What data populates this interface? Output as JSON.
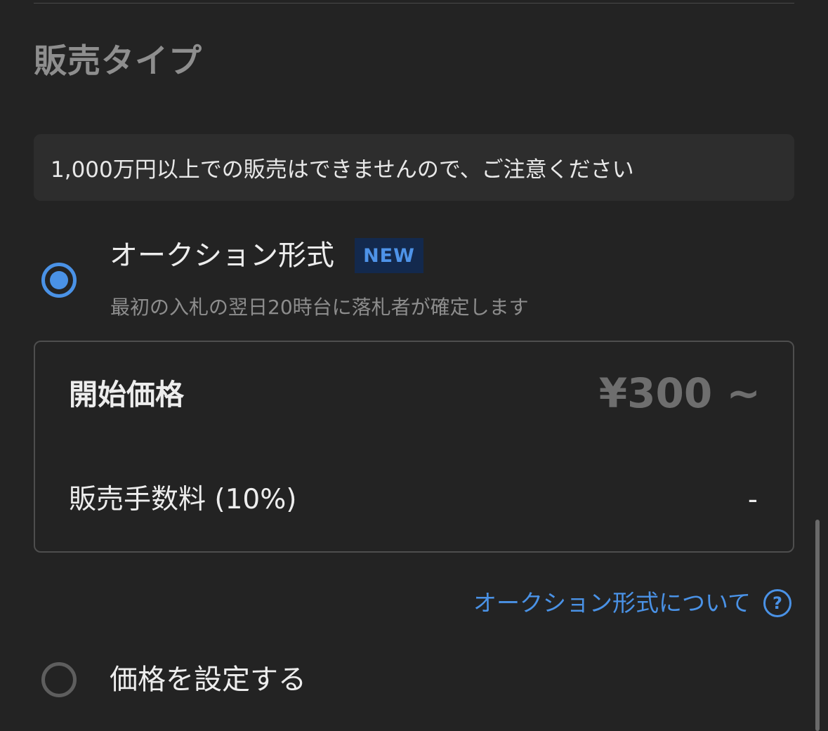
{
  "section": {
    "title": "販売タイプ"
  },
  "notice": {
    "text": "1,000万円以上での販売はできませんので、ご注意ください"
  },
  "options": [
    {
      "title": "オークション形式",
      "badge": "NEW",
      "subtitle": "最初の入札の翌日20時台に落札者が確定します",
      "selected": true
    },
    {
      "title": "価格を設定する",
      "selected": false
    }
  ],
  "price_box": {
    "start_label": "開始価格",
    "start_value": "¥300 ~",
    "fee_label": "販売手数料 (10%)",
    "fee_value": "-"
  },
  "about": {
    "link_text": "オークション形式について",
    "help_icon": "?"
  },
  "colors": {
    "background": "#232323",
    "accent": "#4a92e6",
    "badge_bg": "#13294d",
    "muted_text": "#8d8d8d"
  }
}
